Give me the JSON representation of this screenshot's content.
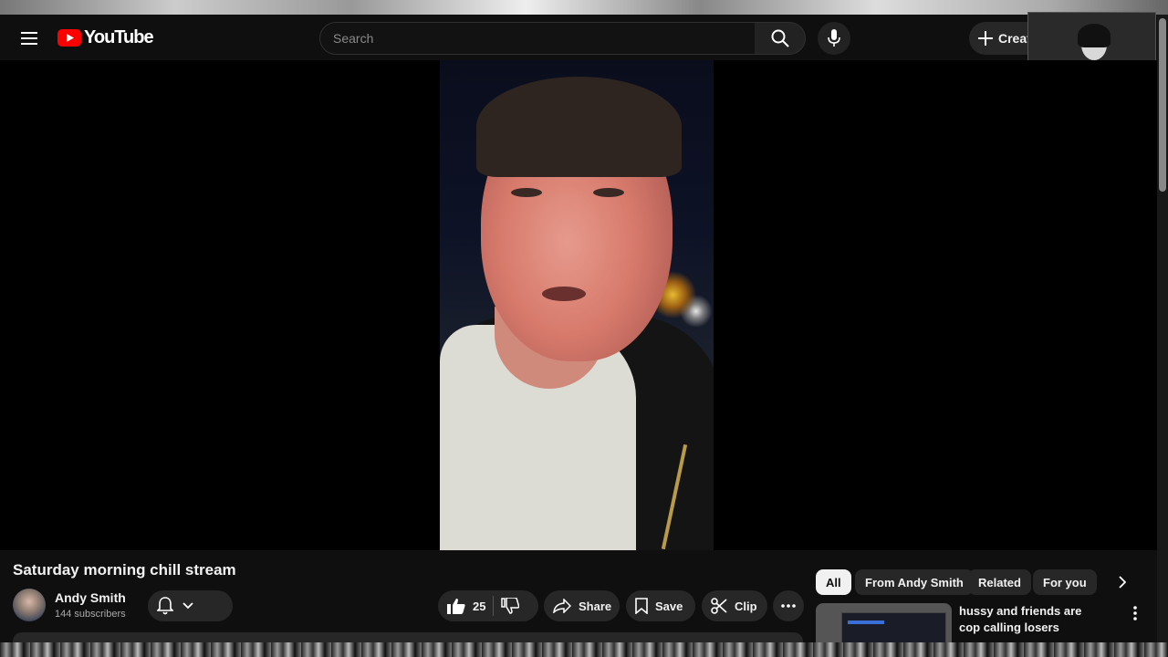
{
  "header": {
    "logo_text": "YouTube",
    "search": {
      "placeholder": "Search",
      "value": ""
    },
    "create_label": "Creat"
  },
  "video": {
    "title": "Saturday morning chill stream"
  },
  "channel": {
    "name": "Andy Smith",
    "subscribers": "144 subscribers"
  },
  "actions": {
    "like_count": "25",
    "share_label": "Share",
    "save_label": "Save",
    "clip_label": "Clip"
  },
  "chips": [
    "All",
    "From Andy Smith",
    "Related",
    "For you"
  ],
  "recommendations": [
    {
      "title": "hussy and friends are cop calling losers"
    }
  ],
  "icons": {
    "menu": "hamburger-icon",
    "search": "search-icon",
    "mic": "mic-icon",
    "create": "plus-icon",
    "bell": "bell-icon",
    "like": "thumbs-up-icon",
    "dislike": "thumbs-down-icon",
    "share": "share-arrow-icon",
    "save": "bookmark-icon",
    "clip": "scissors-icon",
    "more": "more-horiz-icon",
    "next": "chevron-right-icon"
  },
  "colors": {
    "background": "#0f0f0f",
    "brand_red": "#ff0000",
    "chip_active_bg": "#f1f1f1",
    "pill_bg": "#272727"
  }
}
